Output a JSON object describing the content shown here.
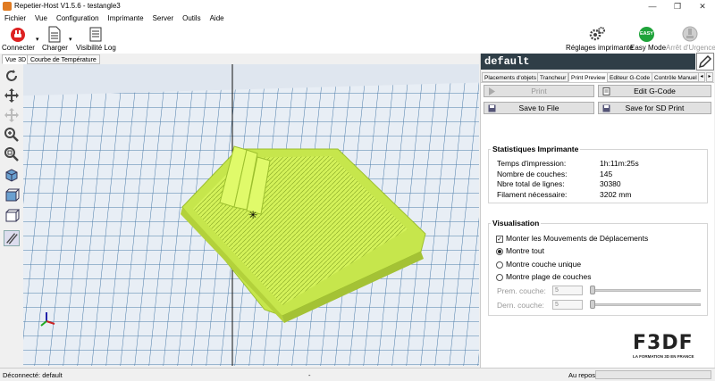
{
  "window": {
    "title": "Repetier-Host V1.5.6 - testangle3"
  },
  "menu": [
    "Fichier",
    "Vue",
    "Configuration",
    "Imprimante",
    "Server",
    "Outils",
    "Aide"
  ],
  "toolbar": {
    "connect": "Connecter",
    "load": "Charger",
    "log": "Visibilité Log",
    "printer_settings": "Réglages imprimante",
    "easy_mode": "Easy Mode",
    "easy_badge": "EASY",
    "emergency": "Arrêt d'Urgence"
  },
  "left_tabs": [
    "Vue 3D",
    "Courbe de Température"
  ],
  "right": {
    "header": "default",
    "tabs": [
      "Placements d'objets",
      "Trancheur",
      "Print Preview",
      "Editeur G-Code",
      "Contrôle Manuel"
    ],
    "buttons": {
      "print": "Print",
      "edit_gcode": "Edit G-Code",
      "save_file": "Save to File",
      "save_sd": "Save for SD Print"
    },
    "stats": {
      "title": "Statistiques Imprimante",
      "rows": [
        {
          "label": "Temps d'impression:",
          "value": "1h:11m:25s"
        },
        {
          "label": "Nombre de couches:",
          "value": "145"
        },
        {
          "label": "Nbre total de lignes:",
          "value": "30380"
        },
        {
          "label": "Filament nécessaire:",
          "value": "3202 mm"
        }
      ]
    },
    "visualisation": {
      "title": "Visualisation",
      "show_travel": "Monter les Mouvements de Déplacements",
      "show_all": "Montre tout",
      "show_single": "Montre couche unique",
      "show_range": "Montre plage de couches",
      "first_layer": "Prem. couche:",
      "last_layer": "Dern. couche:",
      "first_value": "5",
      "last_value": "5"
    },
    "logo": {
      "brand": "F3DF",
      "tagline": "LA FORMATION 3D EN FRANCE"
    }
  },
  "status": {
    "left": "Déconnecté: default",
    "dash": "-",
    "right": "Au repos"
  },
  "colors": {
    "model": "#d4f25a",
    "bed_grid": "#4a7ba8",
    "header": "#2f3e47"
  }
}
